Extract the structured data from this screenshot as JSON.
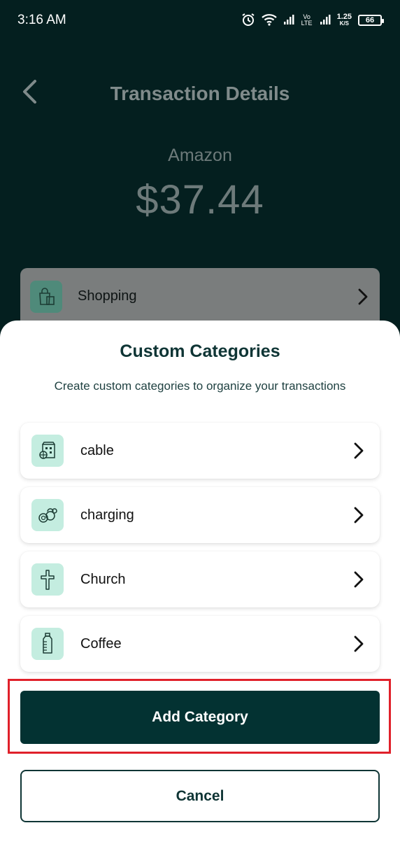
{
  "status_bar": {
    "time": "3:16 AM",
    "network_speed": "1.25",
    "network_speed_unit": "K/S",
    "volte": "Vo LTE",
    "battery": "66",
    "icons": [
      "alarm-icon",
      "wifi-icon",
      "signal-icon",
      "volte-icon",
      "signal-icon",
      "battery-icon"
    ]
  },
  "header": {
    "title": "Transaction Details",
    "back_icon": "chevron-left-icon"
  },
  "transaction": {
    "merchant": "Amazon",
    "amount": "$37.44",
    "category": {
      "label": "Shopping",
      "icon": "shopping-bag-icon"
    }
  },
  "sheet": {
    "title": "Custom Categories",
    "subtitle": "Create custom categories to organize your transactions",
    "items": [
      {
        "label": "cable",
        "icon": "building-icon"
      },
      {
        "label": "charging",
        "icon": "kettlebell-icon"
      },
      {
        "label": "Church",
        "icon": "cross-icon"
      },
      {
        "label": "Coffee",
        "icon": "bottle-icon"
      }
    ],
    "add_button": "Add Category",
    "cancel_button": "Cancel"
  },
  "colors": {
    "background": "#041f1f",
    "primary": "#033232",
    "icon_bg": "#c4ede0",
    "highlight": "#e0202a"
  }
}
